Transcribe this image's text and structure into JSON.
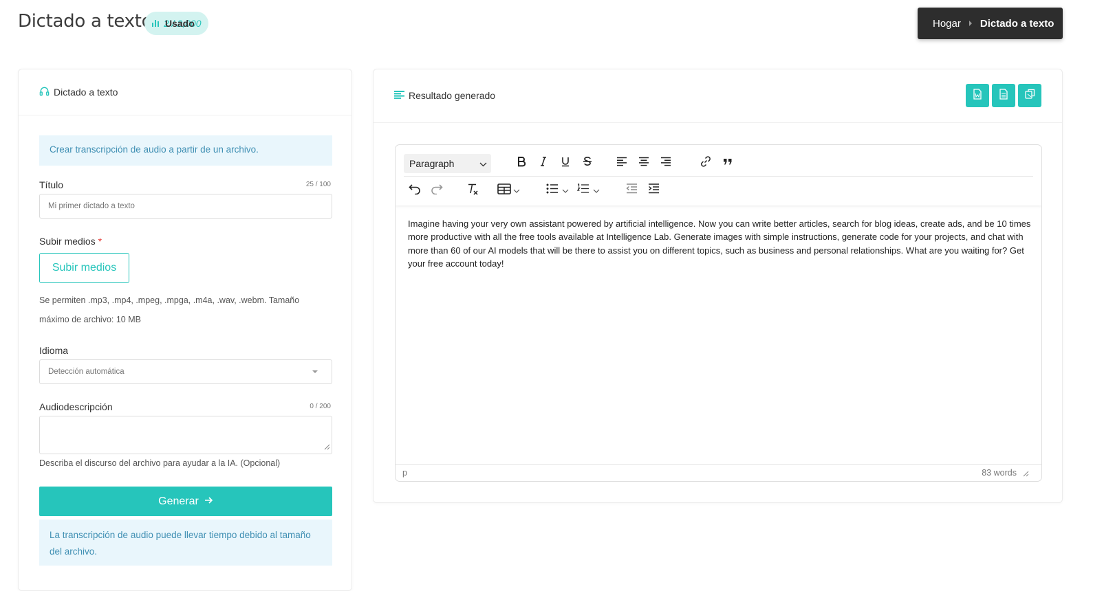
{
  "header": {
    "title": "Dictado a texto",
    "usage_count": "2 / 2,000",
    "usage_label": "Usado"
  },
  "breadcrumb": {
    "home": "Hogar",
    "current": "Dictado a texto"
  },
  "form": {
    "card_title": "Dictado a texto",
    "info_text": "Crear transcripción de audio a partir de un archivo.",
    "title_label": "Título",
    "title_counter": "25 / 100",
    "title_placeholder": "Mi primer dictado a texto",
    "upload_label": "Subir medios",
    "upload_required": "*",
    "upload_button": "Subir medios",
    "upload_hint": "Se permiten .mp3, .mp4, .mpeg, .mpga, .m4a, .wav, .webm. Tamaño máximo de archivo: 10 MB",
    "language_label": "Idioma",
    "language_value": "Detección automática",
    "desc_label": "Audiodescripción",
    "desc_counter": "0 / 200",
    "desc_hint": "Describa el discurso del archivo para ayudar a la IA. (Opcional)",
    "generate_button": "Generar",
    "note": "La transcripción de audio puede llevar tiempo debido al tamaño del archivo."
  },
  "result": {
    "card_title": "Resultado generado",
    "actions": [
      {
        "icon": "word-file-icon"
      },
      {
        "icon": "text-file-icon"
      },
      {
        "icon": "copy-icon"
      }
    ]
  },
  "editor": {
    "block_format": "Paragraph",
    "content": "Imagine having your very own assistant powered by artificial intelligence. Now you can write better articles, search for blog ideas, create ads, and be 10 times more productive with all the free tools available at Intelligence Lab. Generate images with simple instructions, generate code for your projects, and chat with more than 60 of our AI models that will be there to assist you on different topics, such as business and personal relationships. What are you waiting for? Get your free account today!",
    "path": "p",
    "word_count": "83 words"
  },
  "colors": {
    "accent": "#26c5bb",
    "info_bg": "#e9f6fc",
    "info_text": "#3f8fb3",
    "breadcrumb_bg": "#2d2d2d"
  }
}
